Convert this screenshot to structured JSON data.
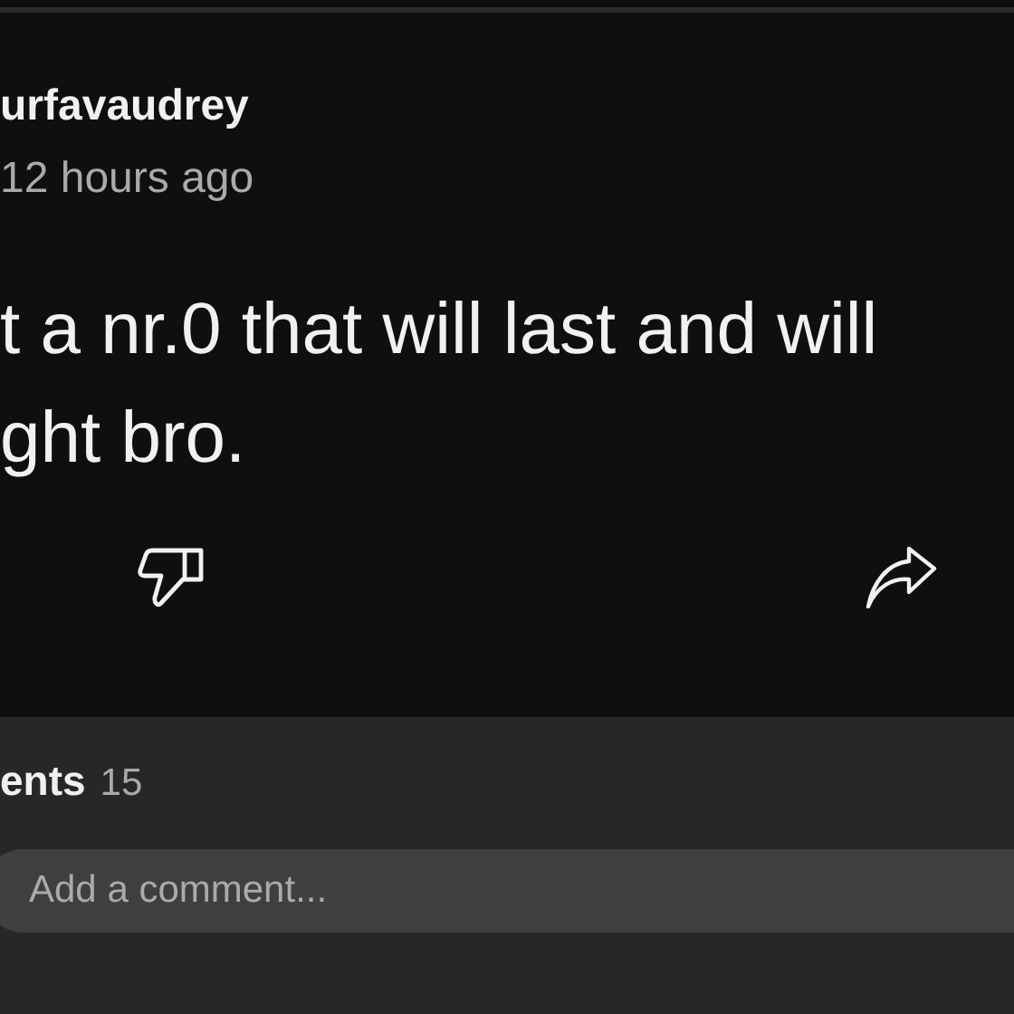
{
  "comment": {
    "author": "urfavaudrey",
    "time": "12 hours ago",
    "text_lines": [
      "t a nr.0 that will last and will",
      "ght bro."
    ]
  },
  "actions": [
    {
      "kind": "dislike"
    },
    {
      "kind": "share"
    }
  ],
  "comments_panel": {
    "heading": "ents",
    "count": "15",
    "input": {
      "placeholder": "Add a comment..."
    }
  }
}
